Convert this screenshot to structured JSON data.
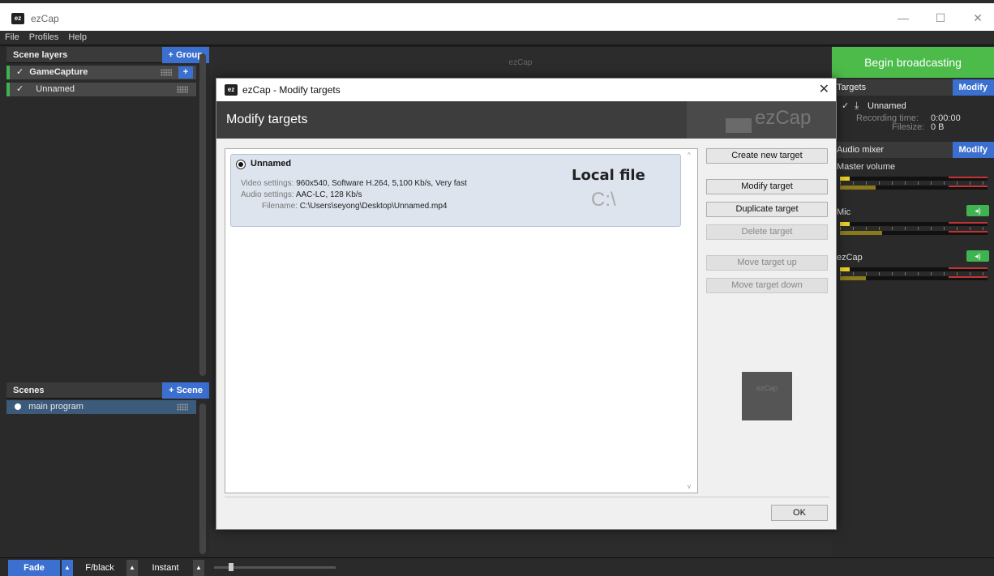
{
  "window": {
    "logo": "ez",
    "title": "ezCap",
    "min": "—",
    "max": "☐",
    "close": "✕"
  },
  "menu": [
    "File",
    "Profiles",
    "Help"
  ],
  "scene_layers": {
    "header": "Scene layers",
    "add_group": "+ Group",
    "add": "+",
    "items": [
      {
        "label": "GameCapture",
        "checked": "✓"
      },
      {
        "label": "Unnamed",
        "checked": "✓"
      }
    ]
  },
  "scenes": {
    "header": "Scenes",
    "add_scene": "+ Scene",
    "items": [
      {
        "label": "main program"
      }
    ]
  },
  "transitions": {
    "fade": "Fade",
    "fblack": "F/black",
    "instant": "Instant",
    "arrow": "▲"
  },
  "preview": {
    "label": "ezCap"
  },
  "broadcast": {
    "label": "Begin broadcasting"
  },
  "targets": {
    "header": "Targets",
    "modify": "Modify",
    "item": {
      "checked": "✓",
      "icon": "download-icon",
      "name": "Unnamed",
      "recording_label": "Recording time:",
      "recording_value": "0:00:00",
      "filesize_label": "Filesize:",
      "filesize_value": "0 B"
    }
  },
  "audio_mixer": {
    "header": "Audio mixer",
    "modify": "Modify",
    "channels": [
      {
        "label": "Master volume"
      },
      {
        "label": "Mic",
        "speaker": "◂)"
      },
      {
        "label": "ezCap",
        "speaker": "◂)"
      }
    ]
  },
  "dialog": {
    "logo": "ez",
    "title": "ezCap - Modify targets",
    "close": "✕",
    "heading": "Modify targets",
    "brand": "ezCap",
    "target": {
      "name": "Unnamed",
      "video_label": "Video settings:",
      "video_value": "960x540, Software H.264, 5,100 Kb/s, Very fast",
      "audio_label": "Audio settings:",
      "audio_value": "AAC-LC, 128 Kb/s",
      "file_label": "Filename:",
      "file_value": "C:\\Users\\seyong\\Desktop\\Unnamed.mp4",
      "type": "Local file",
      "drive": "C:\\"
    },
    "buttons": {
      "create": "Create new target",
      "modify": "Modify target",
      "duplicate": "Duplicate target",
      "delete": "Delete target",
      "up": "Move target up",
      "down": "Move target down"
    },
    "thumb": "ezCap",
    "ok": "OK"
  }
}
